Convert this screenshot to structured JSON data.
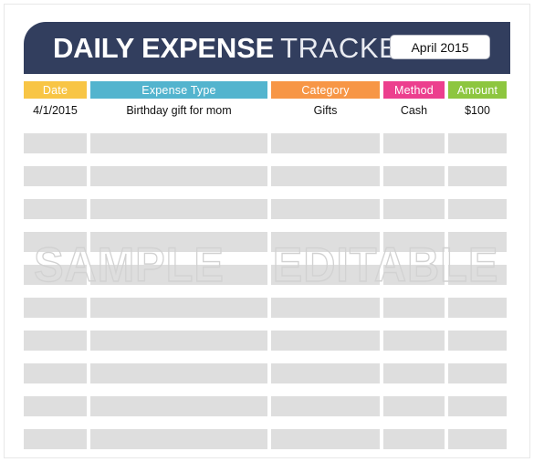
{
  "document": {
    "title_bold": "DAILY EXPENSE",
    "title_light": "TRACKER",
    "month_label": "April 2015"
  },
  "colors": {
    "banner": "#323E5E",
    "date_header": "#F8C545",
    "expense_type_header": "#53B4CE",
    "category_header": "#F79646",
    "method_header": "#EC3F8E",
    "amount_header": "#8DC63F",
    "empty_row": "#dedede",
    "watermark": "#d2d2d2"
  },
  "table": {
    "columns": [
      {
        "key": "date",
        "label": "Date"
      },
      {
        "key": "type",
        "label": "Expense Type"
      },
      {
        "key": "category",
        "label": "Category"
      },
      {
        "key": "method",
        "label": "Method"
      },
      {
        "key": "amount",
        "label": "Amount"
      }
    ],
    "rows": [
      {
        "date": "4/1/2015",
        "type": "Birthday gift for mom",
        "category": "Gifts",
        "method": "Cash",
        "amount": "$100"
      }
    ],
    "empty_row_count": 10
  },
  "watermark": {
    "words": [
      "sample",
      "editable"
    ]
  }
}
